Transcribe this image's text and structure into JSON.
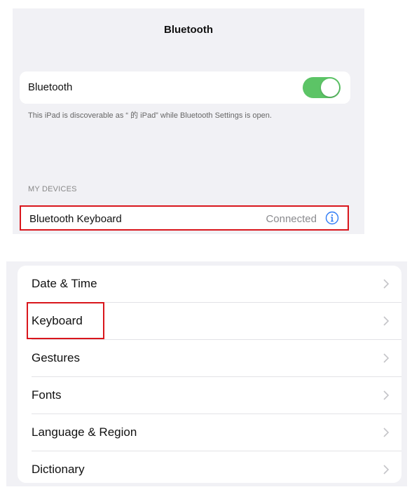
{
  "bluetooth_screen": {
    "title": "Bluetooth",
    "toggle_label": "Bluetooth",
    "toggle_on": true,
    "discover_text": "This iPad is discoverable as “ 的 iPad” while Bluetooth Settings is open.",
    "section_header": "MY DEVICES",
    "device": {
      "name": "Bluetooth Keyboard",
      "status": "Connected",
      "info_icon": "info-icon"
    }
  },
  "general_list": {
    "items": [
      {
        "label": "Date & Time"
      },
      {
        "label": "Keyboard"
      },
      {
        "label": "Gestures"
      },
      {
        "label": "Fonts"
      },
      {
        "label": "Language & Region"
      },
      {
        "label": "Dictionary"
      }
    ],
    "chevron_icon": "chevron-right-icon"
  },
  "colors": {
    "toggle_green": "#5cc466",
    "highlight_red": "#d9161c",
    "info_blue": "#2f7bf5",
    "background": "#f1f1f5"
  }
}
